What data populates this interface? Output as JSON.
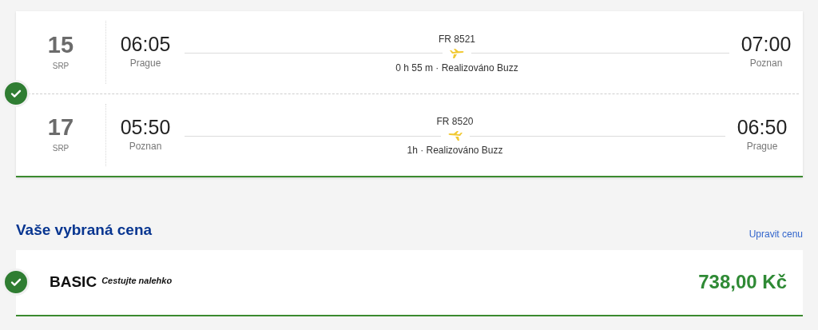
{
  "journey": {
    "selected": true,
    "flights": [
      {
        "day": "15",
        "month": "SRP",
        "depart_time": "06:05",
        "depart_city": "Prague",
        "flight_number": "FR 8521",
        "reversed": false,
        "info": "0 h 55 m · Realizováno Buzz",
        "arrive_time": "07:00",
        "arrive_city": "Poznan"
      },
      {
        "day": "17",
        "month": "SRP",
        "depart_time": "05:50",
        "depart_city": "Poznan",
        "flight_number": "FR 8520",
        "reversed": true,
        "info": "1h · Realizováno Buzz",
        "arrive_time": "06:50",
        "arrive_city": "Prague"
      }
    ]
  },
  "fare_section": {
    "heading": "Vaše vybraná cena",
    "edit_link": "Upravit cenu",
    "fare": {
      "selected": true,
      "name": "BASIC",
      "tagline": "Cestujte nalehko",
      "price": "738,00 Kč"
    }
  }
}
